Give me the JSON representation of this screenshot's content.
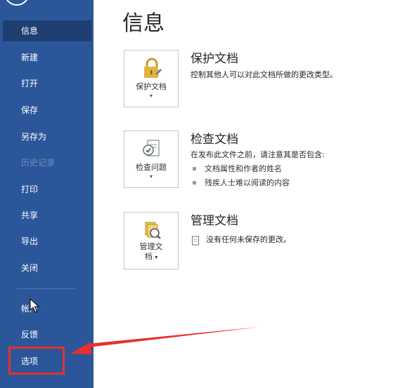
{
  "colors": {
    "sidebar_bg": "#2b579a",
    "sidebar_active": "#1f3f73",
    "annotation_red": "#e8302a"
  },
  "sidebar": {
    "items": [
      {
        "label": "信息",
        "active": true
      },
      {
        "label": "新建"
      },
      {
        "label": "打开"
      },
      {
        "label": "保存"
      },
      {
        "label": "另存为"
      },
      {
        "label": "历史记录",
        "disabled": true
      },
      {
        "label": "打印"
      },
      {
        "label": "共享"
      },
      {
        "label": "导出"
      },
      {
        "label": "关闭"
      },
      {
        "label": "帐户"
      },
      {
        "label": "反馈"
      },
      {
        "label": "选项",
        "highlighted": true
      }
    ]
  },
  "main": {
    "title": "信息",
    "sections": [
      {
        "button_label": "保护文档",
        "icon": "lock-icon",
        "title": "保护文档",
        "description": "控制其他人可以对此文档所做的更改类型。"
      },
      {
        "button_label": "检查问题",
        "icon": "inspect-document-icon",
        "title": "检查文档",
        "description": "在发布此文件之前，请注意其是否包含:",
        "bullets": [
          "文档属性和作者的姓名",
          "残疾人士难以阅读的内容"
        ]
      },
      {
        "button_label_line1": "管理文",
        "button_label_line2": "档",
        "icon": "manage-document-icon",
        "title": "管理文档",
        "note": "没有任何未保存的更改。"
      }
    ]
  }
}
